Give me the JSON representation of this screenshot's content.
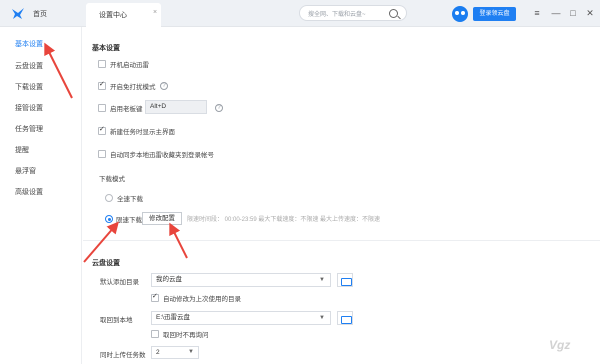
{
  "topbar": {
    "home_label": "首页",
    "tab_label": "设置中心",
    "tab_close": "×",
    "search_placeholder": "搜全网、下载和云盘~",
    "login_label": "登录领云盘",
    "menu_icon": "≡",
    "minimize_icon": "—",
    "maximize_icon": "□",
    "close_icon": "✕"
  },
  "sidebar": {
    "items": [
      {
        "label": "基本设置",
        "active": true
      },
      {
        "label": "云盘设置"
      },
      {
        "label": "下载设置"
      },
      {
        "label": "接管设置"
      },
      {
        "label": "任务管理"
      },
      {
        "label": "提醒"
      },
      {
        "label": "悬浮窗"
      },
      {
        "label": "高级设置"
      }
    ]
  },
  "basic": {
    "title": "基本设置",
    "autostart": "开机启动迅雷",
    "no_disturb": "开启免打扰模式",
    "boss_key": "启用老板键",
    "boss_key_value": "Alt+D",
    "show_main": "新建任务时显示主界面",
    "auto_sync": "自动同步本地迅雷收藏夹到登录帐号",
    "download_mode_label": "下载模式",
    "full_speed": "全速下载",
    "limit_speed": "限速下载",
    "modify_config": "修改配置",
    "limit_info": "限速时间段： 00:00-23:59   最大下载速度：不限速   最大上传速度：不限速"
  },
  "cloud": {
    "title": "云盘设置",
    "default_dir_label": "默认添加目录",
    "default_dir_value": "我的云盘",
    "auto_modify": "自动修改为上次使用的目录",
    "fetch_local_label": "取回到本地",
    "fetch_local_value": "E:\\迅雷云盘",
    "no_ask": "取回时不再询问",
    "upload_count_label": "同时上传任务数",
    "upload_count_value": "2"
  },
  "watermark": "Vgz",
  "colors": {
    "accent": "#1f7ff2",
    "arrow": "#e8453c"
  }
}
